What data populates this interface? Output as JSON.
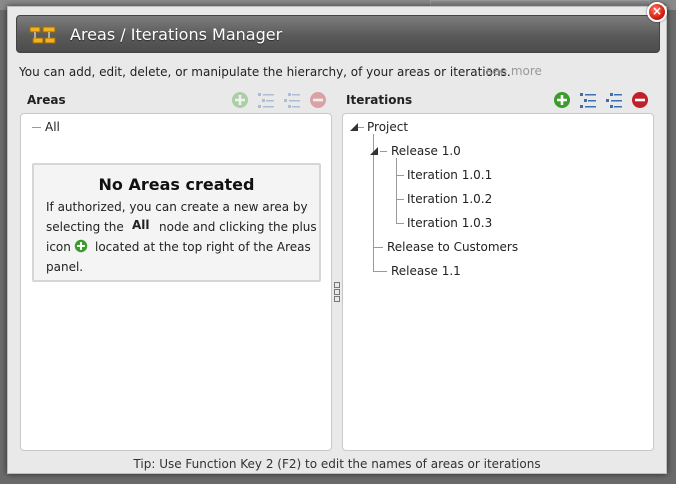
{
  "dialog": {
    "title": "Areas / Iterations Manager",
    "close_label": "×",
    "intro": "You can add, edit, delete, or manipulate the hierarchy, of your areas or iterations.",
    "see_more": "see more",
    "tip": "Tip: Use Function Key 2 (F2) to edit the names of areas or iterations"
  },
  "areas": {
    "header": "Areas",
    "toolbar": [
      "add-icon",
      "indent-icon",
      "outdent-icon",
      "delete-icon"
    ],
    "tree_root": "All",
    "empty": {
      "title": "No Areas created",
      "line1": "If authorized, you can create a new area by",
      "line2_pre": "selecting the",
      "line2_node": "All",
      "line2_post": "node and clicking the plus",
      "line3_pre": "icon",
      "line3_post": "located at the top right of the Areas",
      "line4": "panel."
    }
  },
  "iterations": {
    "header": "Iterations",
    "toolbar": [
      "add-icon",
      "indent-icon",
      "outdent-icon",
      "delete-icon"
    ],
    "tree": {
      "root": "Project",
      "release_1_0": "Release 1.0",
      "iter_1": "Iteration 1.0.1",
      "iter_2": "Iteration 1.0.2",
      "iter_3": "Iteration 1.0.3",
      "release_customers": "Release to Customers",
      "release_1_1": "Release 1.1"
    }
  },
  "colors": {
    "add_green": "#3a9d2a",
    "delete_red": "#c0202a",
    "toolbar_blue": "#3a6fb0",
    "close_red": "#d41e10"
  }
}
